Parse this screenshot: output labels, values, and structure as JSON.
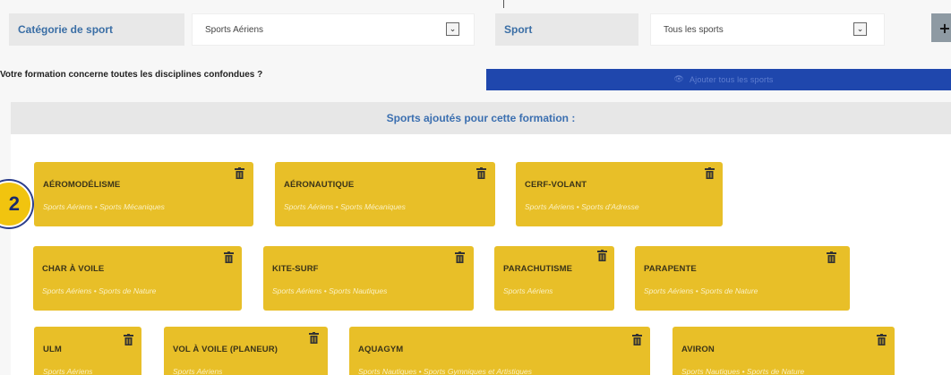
{
  "filters": {
    "category_label": "Catégorie de sport",
    "category_value": "Sports Aériens",
    "sport_label": "Sport",
    "sport_value": "Tous les sports",
    "chevron": "⌄",
    "add_symbol": "+"
  },
  "question": "Votre formation concerne toutes les disciplines confondues ?",
  "add_all_button": "Ajouter tous les sports",
  "section_title": "Sports ajoutés pour cette formation :",
  "badge": "2",
  "colors": {
    "accent_blue": "#1f47ad",
    "card_yellow": "#e8bf28",
    "badge_yellow": "#f1c40f"
  },
  "sports": [
    {
      "name": "AÉROMODÉLISME",
      "categories": "Sports Aériens • Sports Mécaniques"
    },
    {
      "name": "AÉRONAUTIQUE",
      "categories": "Sports Aériens • Sports Mécaniques"
    },
    {
      "name": "CERF-VOLANT",
      "categories": "Sports Aériens • Sports d'Adresse"
    },
    {
      "name": "CHAR À VOILE",
      "categories": "Sports Aériens • Sports de Nature"
    },
    {
      "name": "KITE-SURF",
      "categories": "Sports Aériens • Sports Nautiques"
    },
    {
      "name": "PARACHUTISME",
      "categories": "Sports Aériens"
    },
    {
      "name": "PARAPENTE",
      "categories": "Sports Aériens • Sports de Nature"
    },
    {
      "name": "ULM",
      "categories": "Sports Aériens"
    },
    {
      "name": "VOL À VOILE (PLANEUR)",
      "categories": "Sports Aériens"
    },
    {
      "name": "AQUAGYM",
      "categories": "Sports Nautiques • Sports Gymniques et Artistiques"
    },
    {
      "name": "AVIRON",
      "categories": "Sports Nautiques • Sports de Nature"
    }
  ]
}
